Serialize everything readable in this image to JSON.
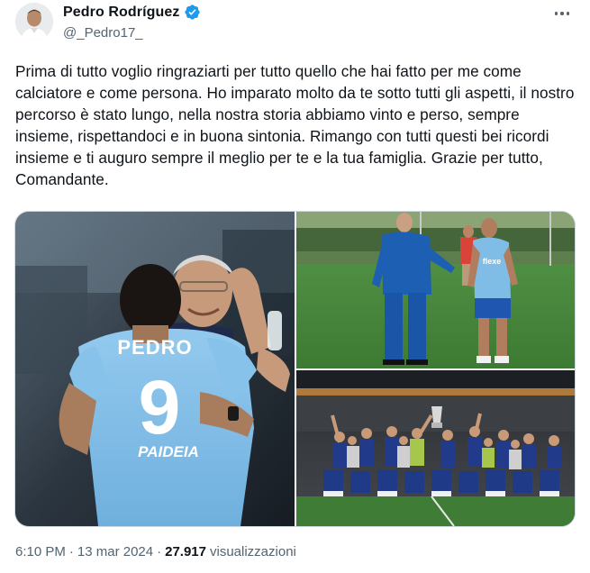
{
  "author": {
    "display_name": "Pedro Rodríguez",
    "handle": "@_Pedro17_",
    "verified": true,
    "avatar_icon": "profile-avatar"
  },
  "tweet": {
    "text": "Prima di tutto voglio ringraziarti per tutto quello che hai fatto per me come calciatore e come persona. Ho imparato molto da te sotto tutti gli aspetti, il nostro percorso è stato lungo, nella nostra storia abbiamo vinto e perso, sempre insieme, rispettandoci e in buona sintonia. Rimango con tutti questi bei ricordi insieme e ti auguro sempre il meglio per te e la tua famiglia. Grazie per tutto, Comandante."
  },
  "photos": {
    "left": {
      "jersey_name": "PEDRO",
      "jersey_number": "9",
      "sponsor": "PAIDEIA"
    },
    "top_right": {
      "shirt_sponsor": "flexe"
    }
  },
  "meta": {
    "time": "6:10 PM",
    "separator": "·",
    "date": "13 mar 2024",
    "views_count": "27.917",
    "views_label": "visualizzazioni"
  },
  "colors": {
    "verified": "#1d9bf0",
    "text_primary": "#0f1419",
    "text_secondary": "#536471",
    "border": "#cfd9de",
    "lazio_blue": "#87c2ea"
  }
}
